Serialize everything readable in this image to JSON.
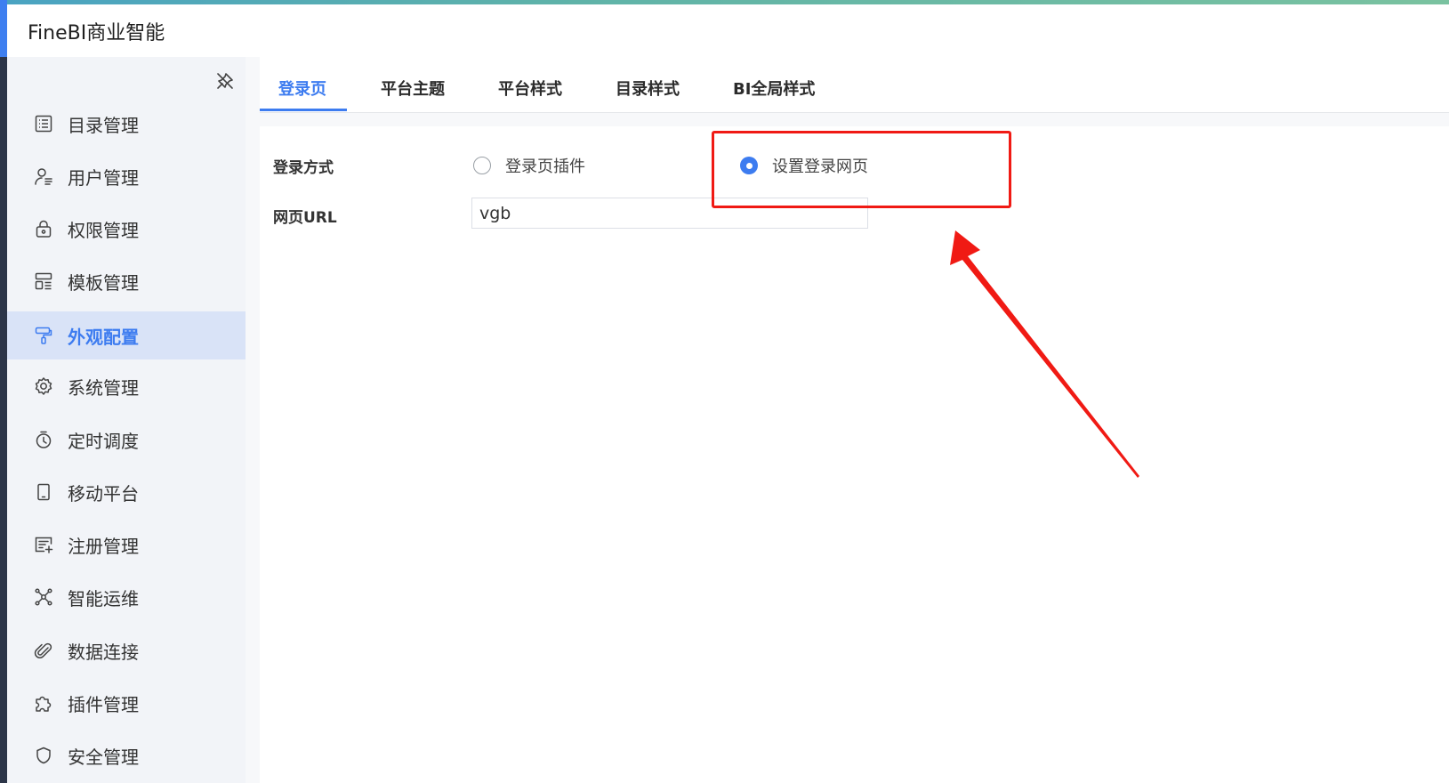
{
  "header": {
    "app_title": "FineBI商业智能"
  },
  "sidebar": {
    "items": [
      {
        "label": "目录管理",
        "icon": "list-icon"
      },
      {
        "label": "用户管理",
        "icon": "user-icon"
      },
      {
        "label": "权限管理",
        "icon": "lock-icon"
      },
      {
        "label": "模板管理",
        "icon": "template-icon"
      },
      {
        "label": "外观配置",
        "icon": "paint-roller-icon",
        "active": true
      },
      {
        "label": "系统管理",
        "icon": "gear-icon"
      },
      {
        "label": "定时调度",
        "icon": "timer-icon"
      },
      {
        "label": "移动平台",
        "icon": "mobile-icon"
      },
      {
        "label": "注册管理",
        "icon": "register-icon"
      },
      {
        "label": "智能运维",
        "icon": "network-icon"
      },
      {
        "label": "数据连接",
        "icon": "paperclip-icon"
      },
      {
        "label": "插件管理",
        "icon": "puzzle-icon"
      },
      {
        "label": "安全管理",
        "icon": "shield-icon"
      }
    ]
  },
  "tabs": [
    {
      "label": "登录页",
      "active": true
    },
    {
      "label": "平台主题"
    },
    {
      "label": "平台样式"
    },
    {
      "label": "目录样式"
    },
    {
      "label": "BI全局样式"
    }
  ],
  "form": {
    "login_method_label": "登录方式",
    "options": [
      {
        "label": "登录页插件",
        "checked": false
      },
      {
        "label": "设置登录网页",
        "checked": true
      }
    ],
    "url_label": "网页URL",
    "url_value": "vgb"
  },
  "colors": {
    "accent": "#3d7cf0",
    "annotation": "#f01a14",
    "sidebar_bg": "#f2f4f8",
    "sidebar_active_bg": "#d9e3f7"
  }
}
